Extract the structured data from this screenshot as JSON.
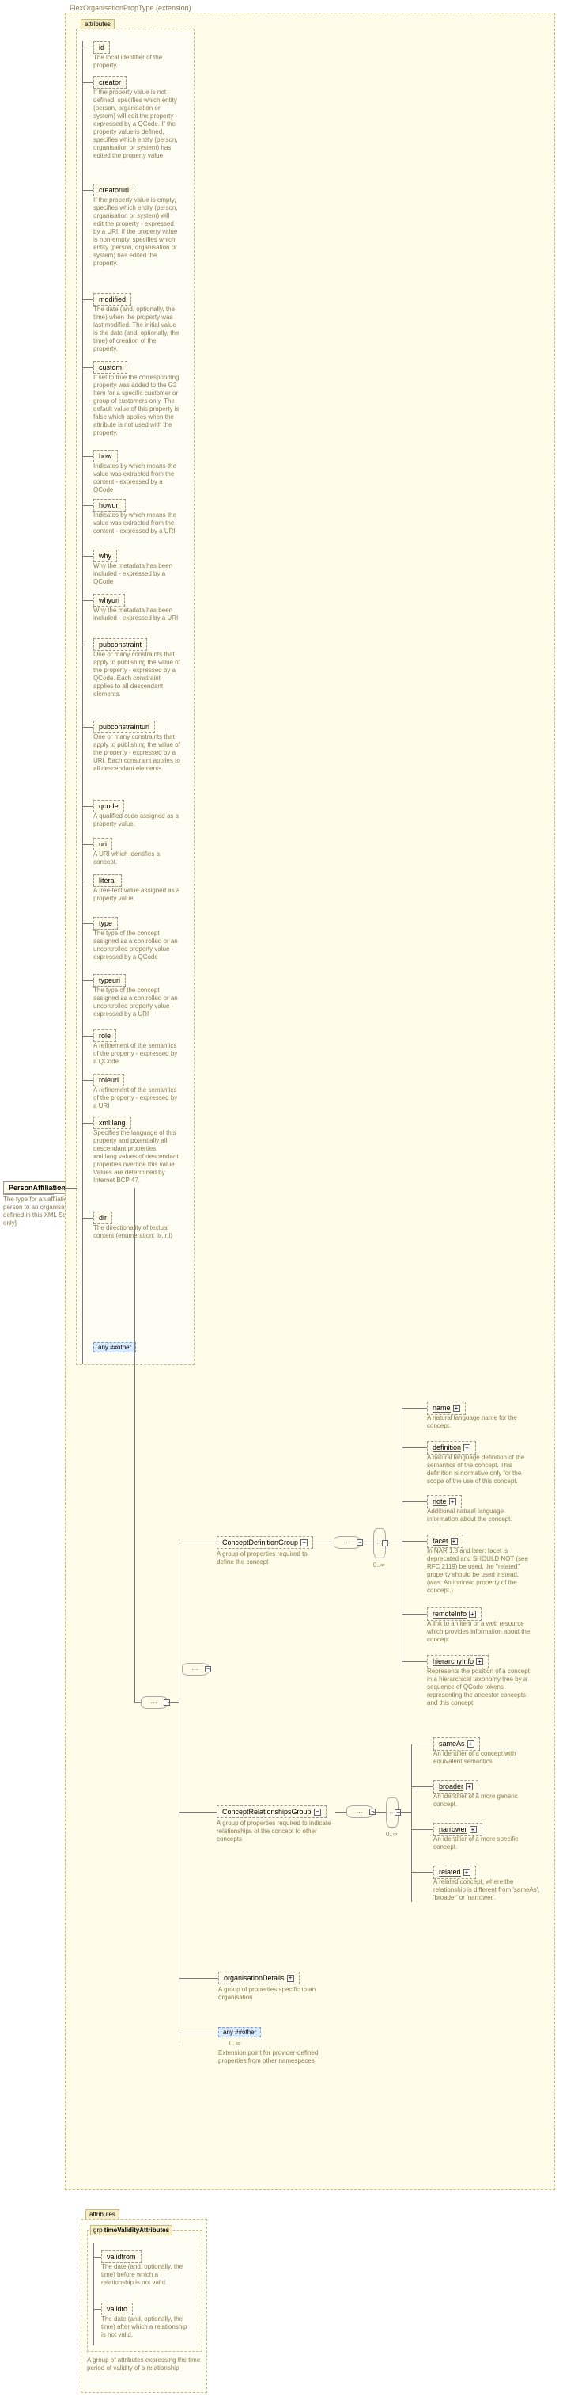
{
  "root": {
    "name": "PersonAffiliationType",
    "desc": "The type for an affliation of a person to an organisation\n[Type defined in this XML Schema only]"
  },
  "extension": {
    "label": "FlexOrganisationPropType (extension)"
  },
  "attributesTab": "attributes",
  "attributes": [
    {
      "name": "id",
      "desc": "The local identifier of the property."
    },
    {
      "name": "creator",
      "desc": "If the property value is not defined, specifies which entity (person, organisation or system) will edit the property - expressed by a QCode. If the property value is defined, specifies which entity (person, organisation or system) has edited the property value."
    },
    {
      "name": "creatoruri",
      "desc": "If the property value is empty, specifies which entity (person, organisation or system) will edit the property - expressed by a URI. If the property value is non-empty, specifies which entity (person, organisation or system) has edited the property."
    },
    {
      "name": "modified",
      "desc": "The date (and, optionally, the time) when the property was last modified. The initial value is the date (and, optionally, the time) of creation of the property."
    },
    {
      "name": "custom",
      "desc": "If set to true the corresponding property was added to the G2 Item for a specific customer or group of customers only. The default value of this property is false which applies when the attribute is not used with the property."
    },
    {
      "name": "how",
      "desc": "Indicates by which means the value was extracted from the content - expressed by a QCode"
    },
    {
      "name": "howuri",
      "desc": "Indicates by which means the value was extracted from the content - expressed by a URI"
    },
    {
      "name": "why",
      "desc": "Why the metadata has been included - expressed by a QCode"
    },
    {
      "name": "whyuri",
      "desc": "Why the metadata has been included - expressed by a URI"
    },
    {
      "name": "pubconstraint",
      "desc": "One or many constraints that apply to publishing the value of the property - expressed by a QCode. Each constraint applies to all descendant elements."
    },
    {
      "name": "pubconstrainturi",
      "desc": "One or many constraints that apply to publishing the value of the property - expressed by a URI. Each constraint applies to all descendant elements."
    },
    {
      "name": "qcode",
      "desc": "A qualified code assigned as a property value."
    },
    {
      "name": "uri",
      "desc": "A URI which identifies a concept."
    },
    {
      "name": "literal",
      "desc": "A free-text value assigned as a property value."
    },
    {
      "name": "type",
      "desc": "The type of the concept assigned as a controlled or an uncontrolled property value - expressed by a QCode"
    },
    {
      "name": "typeuri",
      "desc": "The type of the concept assigned as a controlled or an uncontrolled property value - expressed by a URI"
    },
    {
      "name": "role",
      "desc": "A refinement of the semantics of the property - expressed by a QCode"
    },
    {
      "name": "roleuri",
      "desc": "A refinement of the semantics of the property - expressed by a URI"
    },
    {
      "name": "xmllang",
      "label": "xml:lang",
      "desc": "Specifies the language of this property and potentially all descendant properties. xml:lang values of descendant properties override this value. Values are determined by Internet BCP 47."
    },
    {
      "name": "dir",
      "desc": "The directionality of textual content (enumeration: ltr, rtl)"
    }
  ],
  "anyOther": "any ##other",
  "groups": {
    "cdg": {
      "name": "ConceptDefinitionGroup",
      "desc": "A group of properties required to define the concept",
      "children": [
        {
          "name": "name",
          "solid": true,
          "desc": "A natural language name for the concept."
        },
        {
          "name": "definition",
          "solid": true,
          "desc": "A natural language definition of the semantics of the concept. This definition is normative only for the scope of the use of this concept."
        },
        {
          "name": "note",
          "solid": true,
          "desc": "Additional natural language information about the concept."
        },
        {
          "name": "facet",
          "solid": true,
          "desc": "In NAR 1.8 and later: facet is deprecated and SHOULD NOT (see RFC 2119) be used, the \"related\" property should be used instead. (was: An intrinsic property of the concept.)"
        },
        {
          "name": "remoteInfo",
          "solid": true,
          "desc": "A link to an item or a web resource which provides information about the concept"
        },
        {
          "name": "hierarchyInfo",
          "solid": true,
          "desc": "Represents the position of a concept in a hierarchical taxonomy tree by a sequence of QCode tokens representing the ancestor concepts and this concept"
        }
      ]
    },
    "crg": {
      "name": "ConceptRelationshipsGroup",
      "desc": "A group of properties required to indicate relationships of the concept to other concepts",
      "children": [
        {
          "name": "sameAs",
          "solid": true,
          "desc": "An identifier of a concept with equivalent semantics"
        },
        {
          "name": "broader",
          "solid": true,
          "desc": "An identifier of a more generic concept."
        },
        {
          "name": "narrower",
          "solid": true,
          "desc": "An identifier of a more specific concept."
        },
        {
          "name": "related",
          "solid": true,
          "desc": "A related concept, where the relationship is different from 'sameAs', 'broader' or 'narrower'."
        }
      ]
    }
  },
  "orgDetails": {
    "name": "organisationDetails",
    "desc": "A group of properties specific to an organisation"
  },
  "extPoint": {
    "label": "any ##other",
    "desc": "Extension point for provider-defined properties from other namespaces",
    "occ": "0..∞"
  },
  "tva": {
    "tab": "attributes",
    "grp": "timeValidityAttributes",
    "validfrom": {
      "name": "validfrom",
      "desc": "The date (and, optionally, the time) before which a relationship is not valid."
    },
    "validto": {
      "name": "validto",
      "desc": "The date (and, optionally, the time) after which a relationship is not valid."
    },
    "desc": "A group of attributes expressing the time period of validity of a relationship"
  },
  "grpTab": "grp",
  "occInf": "0..∞",
  "chart_data": {
    "type": "tree",
    "nodes": [
      "PersonAffiliationType",
      "FlexOrganisationPropType (extension)",
      "attributes[id,creator,creatoruri,modified,custom,how,howuri,why,whyuri,pubconstraint,pubconstrainturi,qcode,uri,literal,type,typeuri,role,roleuri,xml:lang,dir,any##other]",
      "ConceptDefinitionGroup[name,definition,note,facet,remoteInfo,hierarchyInfo]",
      "ConceptRelationshipsGroup[sameAs,broader,narrower,related]",
      "organisationDetails",
      "any ##other",
      "timeValidityAttributes[validfrom,validto]"
    ]
  }
}
